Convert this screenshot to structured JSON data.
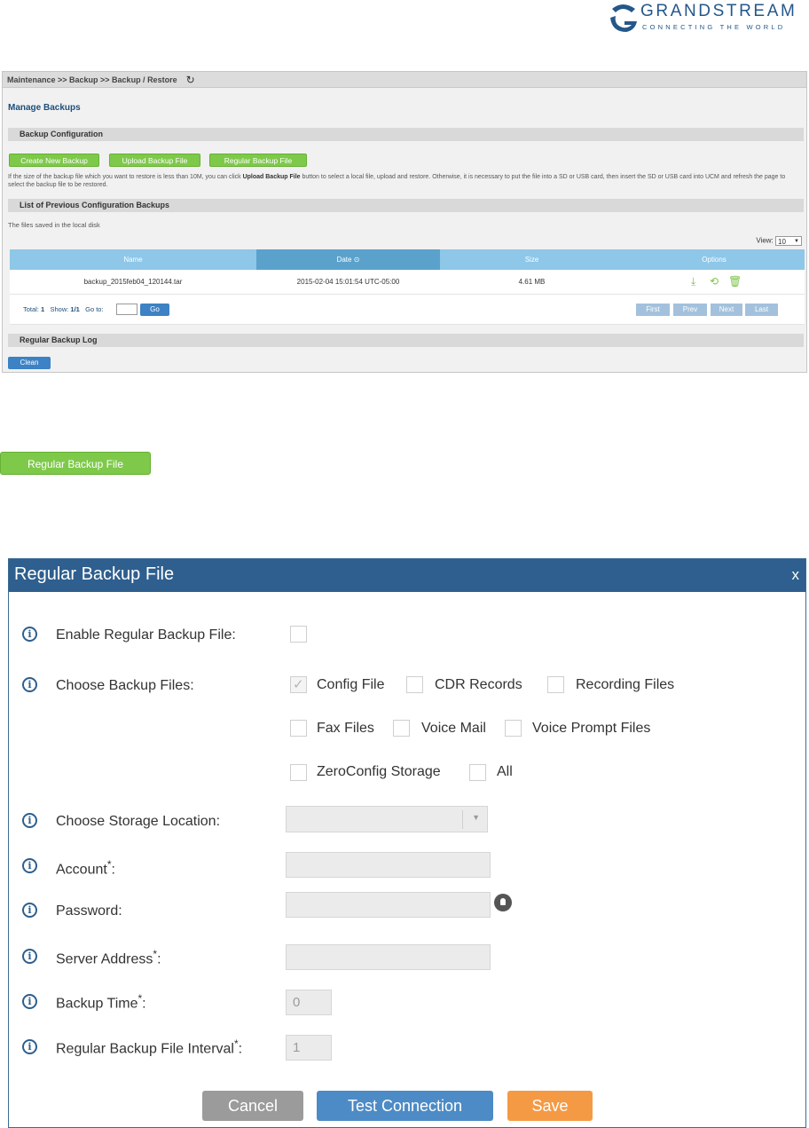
{
  "logo": {
    "name": "GRANDSTREAM",
    "tagline": "CONNECTING THE WORLD"
  },
  "panel": {
    "breadcrumb": "Maintenance >> Backup >> Backup / Restore",
    "title": "Manage Backups",
    "backup_config_header": "Backup Configuration",
    "buttons": [
      "Create New Backup",
      "Upload Backup File",
      "Regular Backup File"
    ],
    "note_pre": "If the size of the backup file which you want to restore is less than 10M, you can click ",
    "note_bold": "Upload Backup File",
    "note_post": " button to select a local file, upload and restore. Otherwise, it is necessary to put the file into a SD or USB card, then insert the SD or USB card into UCM and refresh the page to select the backup file to be restored.",
    "list_header": "List of Previous Configuration Backups",
    "local_text": "The files saved in the local disk",
    "view_label": "View:",
    "view_value": "10",
    "columns": [
      "Name",
      "Date",
      "Size",
      "Options"
    ],
    "row": {
      "name": "backup_2015feb04_120144.tar",
      "date": "2015-02-04 15:01:54 UTC-05:00",
      "size": "4.61 MB"
    },
    "pager": {
      "total_label": "Total:",
      "total": "1",
      "show_label": "Show:",
      "show": "1/1",
      "goto_label": "Go to:",
      "go": "Go",
      "first": "First",
      "prev": "Prev",
      "next": "Next",
      "last": "Last"
    },
    "log_header": "Regular Backup Log",
    "clean": "Clean"
  },
  "standalone_button": "Regular Backup File",
  "dialog": {
    "title": "Regular Backup File",
    "close": "x",
    "labels": {
      "enable": "Enable Regular Backup File:",
      "choose_files": "Choose Backup Files:",
      "storage": "Choose Storage Location:",
      "account": "Account",
      "password": "Password:",
      "server": "Server Address",
      "backup_time": "Backup Time",
      "interval": "Regular Backup File Interval",
      "required": "*",
      "colon": ":"
    },
    "file_options": [
      "Config File",
      "CDR Records",
      "Recording Files",
      "Fax Files",
      "Voice Mail",
      "Voice Prompt Files",
      "ZeroConfig Storage",
      "All"
    ],
    "backup_time_value": "0",
    "interval_value": "1",
    "cancel": "Cancel",
    "test": "Test Connection",
    "save": "Save"
  },
  "colors": {
    "brand_blue": "#2e5f8e",
    "green": "#7ec94a",
    "save_orange": "#f59a44",
    "test_blue": "#4d8bc6",
    "cancel_gray": "#9b9b9b"
  }
}
